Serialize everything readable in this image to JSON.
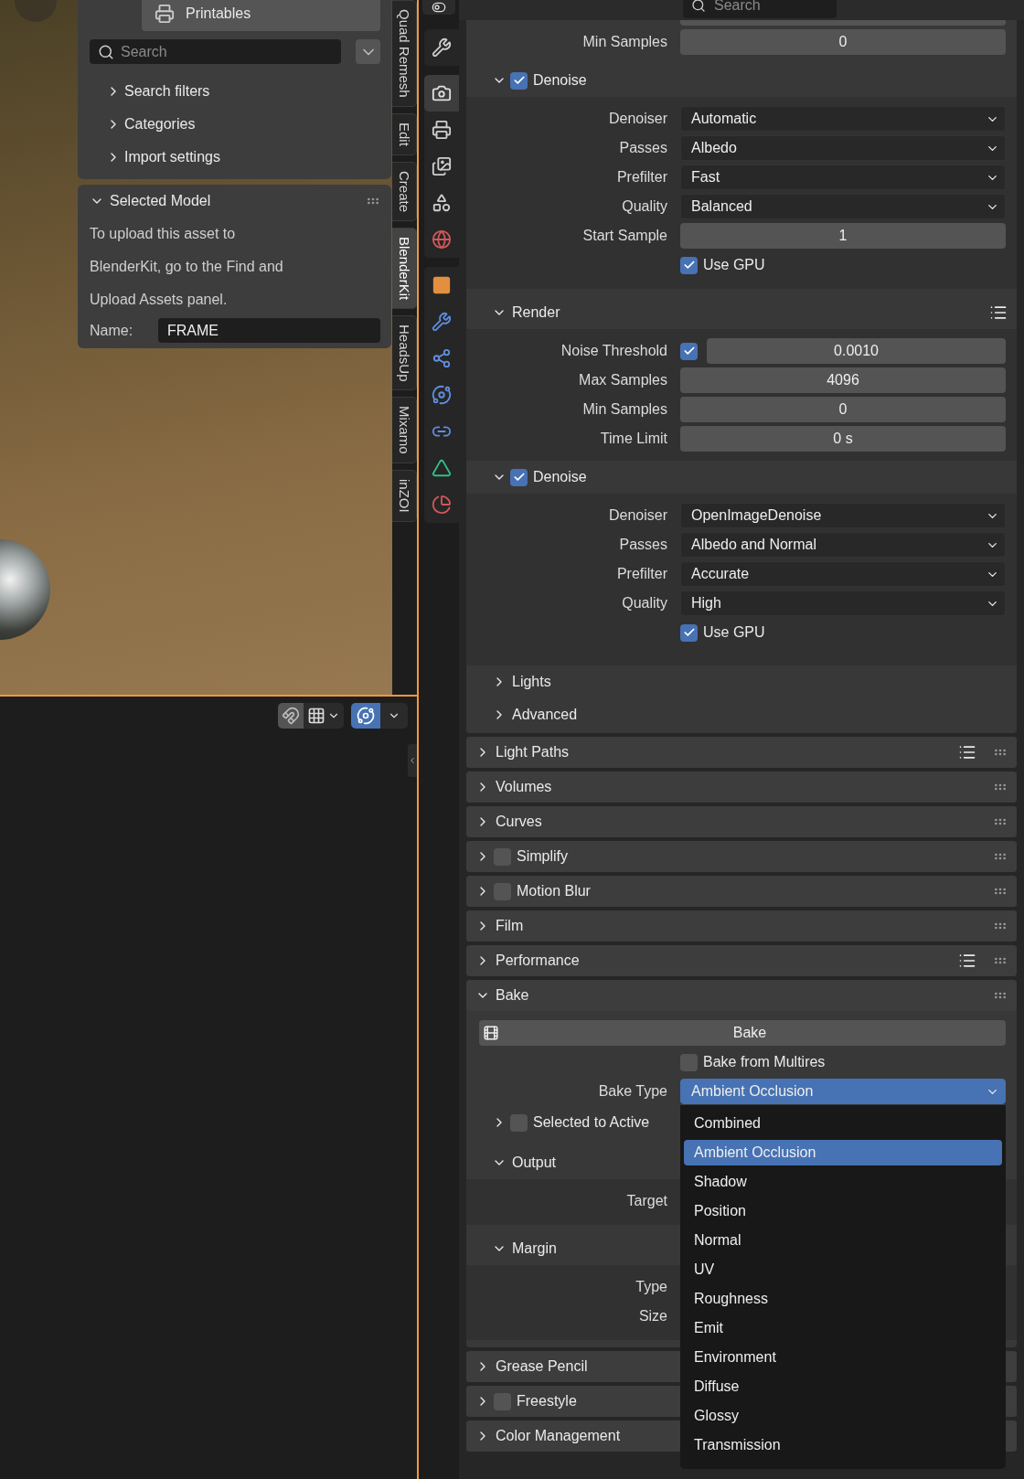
{
  "viewport": {
    "sidebar_tabs": [
      {
        "label": "Quad Remesh",
        "selected": false
      },
      {
        "label": "Edit",
        "selected": false
      },
      {
        "label": "Create",
        "selected": false
      },
      {
        "label": "BlenderKit",
        "selected": true
      },
      {
        "label": "HeadsUp",
        "selected": false
      },
      {
        "label": "Mixamo",
        "selected": false
      },
      {
        "label": "inZOI",
        "selected": false
      }
    ],
    "blenderkit": {
      "asset_type": "Printables",
      "search": {
        "placeholder": "Search"
      },
      "sections": [
        {
          "label": "Search filters",
          "expanded": false
        },
        {
          "label": "Categories",
          "expanded": false
        },
        {
          "label": "Import settings",
          "expanded": false
        }
      ],
      "selected_model": {
        "title": "Selected Model",
        "expanded": true,
        "message_lines": [
          "To upload this asset to",
          "BlenderKit, go to the Find and",
          "Upload Assets panel."
        ],
        "name_label": "Name:",
        "name_value": "FRAME"
      }
    }
  },
  "lower_editor": {
    "overlays_on": true
  },
  "property_tab_groups": [
    {
      "tabs": [
        {
          "kind": "tool",
          "selected": false
        }
      ]
    },
    {
      "tabs": [
        {
          "kind": "render",
          "selected": true
        },
        {
          "kind": "output",
          "selected": false
        },
        {
          "kind": "view_layer",
          "selected": false
        },
        {
          "kind": "scene",
          "selected": false
        },
        {
          "kind": "world",
          "selected": false
        }
      ]
    },
    {
      "tabs": [
        {
          "kind": "object",
          "selected": false
        },
        {
          "kind": "modifier",
          "selected": false
        },
        {
          "kind": "particles",
          "selected": false
        },
        {
          "kind": "physics",
          "selected": false
        },
        {
          "kind": "constraints",
          "selected": false
        },
        {
          "kind": "data",
          "selected": false
        },
        {
          "kind": "material",
          "selected": false
        }
      ]
    }
  ],
  "properties": {
    "search": {
      "placeholder": "Search"
    },
    "sampling": [
      {
        "kind": "number",
        "label": "Min Samples",
        "value": "0"
      },
      {
        "kind": "subpanel",
        "label": "Denoise",
        "expanded": true,
        "checked": true,
        "children": [
          {
            "kind": "select",
            "label": "Denoiser",
            "value": "Automatic"
          },
          {
            "kind": "select",
            "label": "Passes",
            "value": "Albedo"
          },
          {
            "kind": "select",
            "label": "Prefilter",
            "value": "Fast"
          },
          {
            "kind": "select",
            "label": "Quality",
            "value": "Balanced"
          },
          {
            "kind": "number",
            "label": "Start Sample",
            "value": "1"
          },
          {
            "kind": "toggle",
            "label": "Use GPU",
            "checked": true
          }
        ]
      },
      {
        "kind": "subpanel",
        "label": "Render",
        "expanded": true,
        "presets": true,
        "children": [
          {
            "kind": "number",
            "label": "Noise Threshold",
            "value": "0.0010",
            "checked": true
          },
          {
            "kind": "number",
            "label": "Max Samples",
            "value": "4096"
          },
          {
            "kind": "number",
            "label": "Min Samples",
            "value": "0"
          },
          {
            "kind": "number",
            "label": "Time Limit",
            "value": "0 s"
          },
          {
            "kind": "subpanel",
            "label": "Denoise",
            "expanded": true,
            "checked": true,
            "children": [
              {
                "kind": "select",
                "label": "Denoiser",
                "value": "OpenImageDenoise"
              },
              {
                "kind": "select",
                "label": "Passes",
                "value": "Albedo and Normal"
              },
              {
                "kind": "select",
                "label": "Prefilter",
                "value": "Accurate"
              },
              {
                "kind": "select",
                "label": "Quality",
                "value": "High"
              },
              {
                "kind": "toggle",
                "label": "Use GPU",
                "checked": true
              }
            ]
          }
        ]
      },
      {
        "kind": "subpanel",
        "label": "Lights",
        "expanded": false
      },
      {
        "kind": "subpanel",
        "label": "Advanced",
        "expanded": false
      }
    ],
    "panels": [
      {
        "label": "Light Paths",
        "expanded": false,
        "presets": true
      },
      {
        "label": "Volumes",
        "expanded": false
      },
      {
        "label": "Curves",
        "expanded": false
      },
      {
        "label": "Simplify",
        "expanded": false,
        "checked": false
      },
      {
        "label": "Motion Blur",
        "expanded": false,
        "checked": false
      },
      {
        "label": "Film",
        "expanded": false
      },
      {
        "label": "Performance",
        "expanded": false,
        "presets": true
      },
      {
        "label": "Bake",
        "expanded": true,
        "children": [
          {
            "kind": "button",
            "label": "Bake"
          },
          {
            "kind": "toggle",
            "label": "Bake from Multires",
            "checked": false
          },
          {
            "kind": "select",
            "label": "Bake Type",
            "value": "Ambient Occlusion",
            "open": true,
            "menu": [
              {
                "label": "Combined",
                "selected": false
              },
              {
                "label": "Ambient Occlusion",
                "selected": true
              },
              {
                "label": "Shadow",
                "selected": false
              },
              {
                "label": "Position",
                "selected": false
              },
              {
                "label": "Normal",
                "selected": false
              },
              {
                "label": "UV",
                "selected": false
              },
              {
                "label": "Roughness",
                "selected": false
              },
              {
                "label": "Emit",
                "selected": false
              },
              {
                "label": "Environment",
                "selected": false
              },
              {
                "label": "Diffuse",
                "selected": false
              },
              {
                "label": "Glossy",
                "selected": false
              },
              {
                "label": "Transmission",
                "selected": false
              }
            ]
          },
          {
            "kind": "subpanel",
            "label": "Selected to Active",
            "expanded": false,
            "checked": false
          },
          {
            "kind": "subpanel",
            "label": "Output",
            "expanded": true,
            "children": [
              {
                "kind": "label",
                "label": "Target"
              }
            ]
          },
          {
            "kind": "subpanel",
            "label": "Margin",
            "expanded": true,
            "children": [
              {
                "kind": "label",
                "label": "Type"
              },
              {
                "kind": "label",
                "label": "Size"
              }
            ]
          }
        ]
      },
      {
        "label": "Grease Pencil",
        "expanded": false
      },
      {
        "label": "Freestyle",
        "expanded": false,
        "checked": false
      },
      {
        "label": "Color Management",
        "expanded": false
      }
    ]
  }
}
